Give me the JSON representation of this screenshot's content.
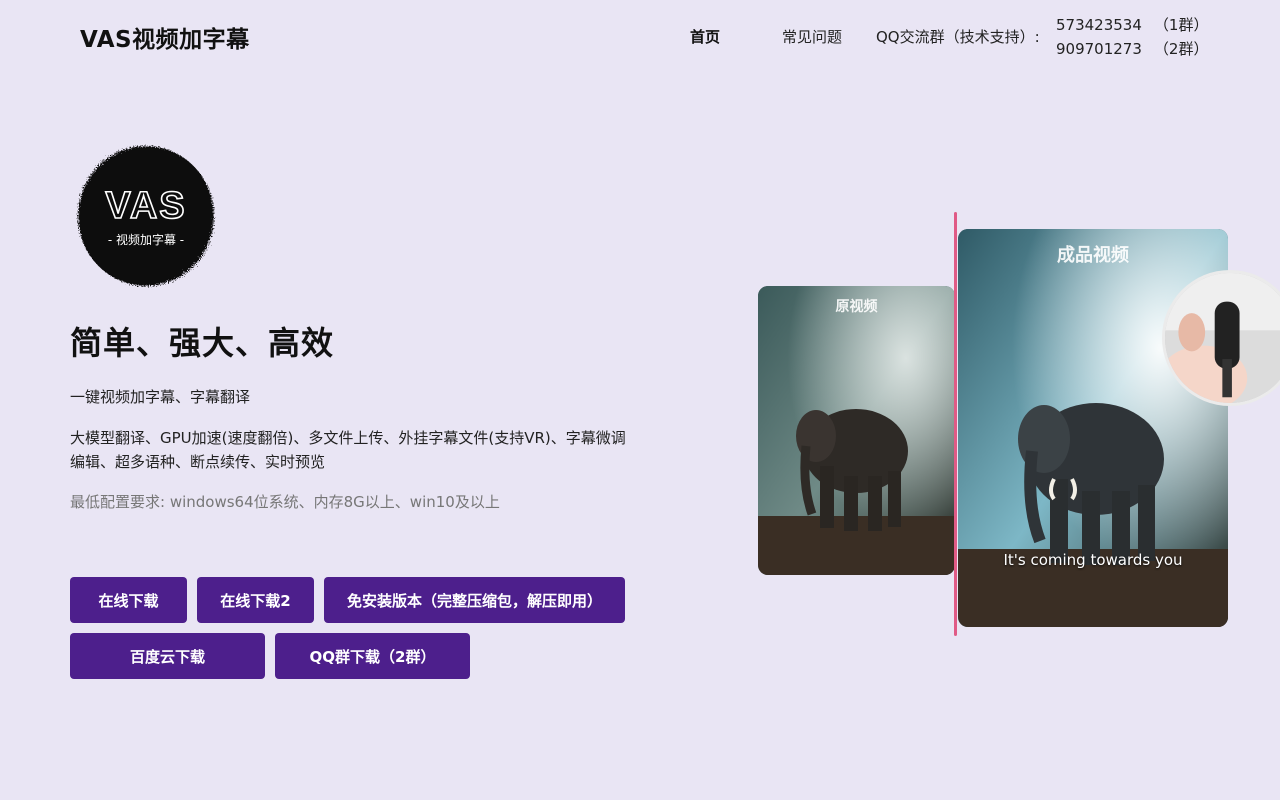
{
  "header": {
    "brand": "VAS视频加字幕",
    "nav": {
      "home": "首页",
      "faq": "常见问题",
      "qq_label": "QQ交流群（技术支持）:",
      "groups": [
        {
          "number": "573423534",
          "tag": "（1群）"
        },
        {
          "number": "909701273",
          "tag": "（2群）"
        }
      ]
    }
  },
  "logo": {
    "text": "VAS",
    "subtext": "- 视频加字幕 -"
  },
  "hero": {
    "headline": "简单、强大、高效",
    "tagline": "一键视频加字幕、字幕翻译",
    "features": "大模型翻译、GPU加速(速度翻倍)、多文件上传、外挂字幕文件(支持VR)、字幕微调编辑、超多语种、断点续传、实时预览",
    "requirements": "最低配置要求: windows64位系统、内存8G以上、win10及以上"
  },
  "buttons": {
    "online_download": "在线下载",
    "online_download_2": "在线下载2",
    "portable": "免安装版本（完整压缩包，解压即用）",
    "baidu": "百度云下载",
    "qq_group": "QQ群下载（2群）"
  },
  "preview": {
    "original_label": "原视频",
    "final_label": "成品视频",
    "subtitle": "It's coming towards you"
  },
  "colors": {
    "background": "#e9e5f4",
    "button": "#4d1f8c",
    "divider": "#e05a86"
  }
}
